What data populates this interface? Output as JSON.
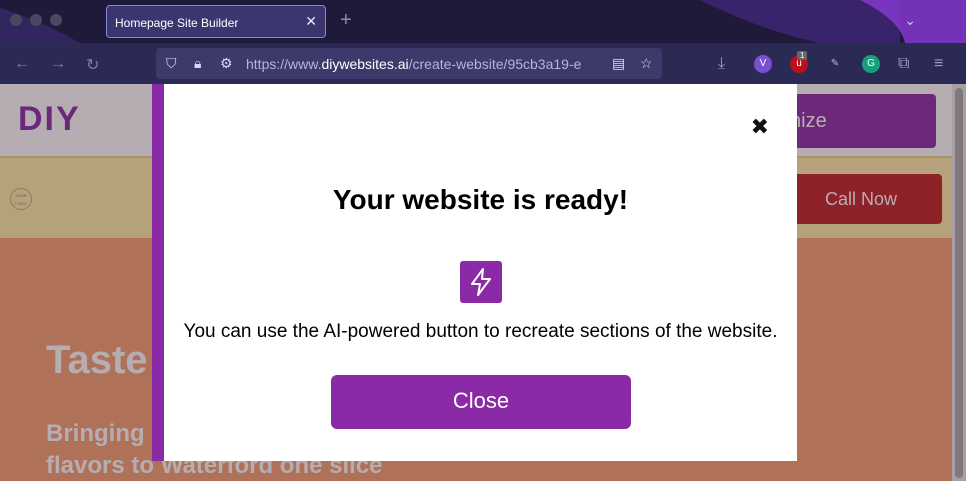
{
  "browser": {
    "tab_title": "Homepage Site Builder",
    "tab_close_glyph": "✕",
    "new_tab_glyph": "+",
    "overflow_glyph": "⌄",
    "url_prefix": "https://www.",
    "url_host": "diywebsites.ai",
    "url_path": "/create-website/95cb3a19-e",
    "extension_badge": "1"
  },
  "site": {
    "logo": "DIY",
    "customize_label": "nize",
    "promo_logo_text": "YOUR LOGO",
    "call_label": "Call Now",
    "hero_title": "Taste",
    "hero_sub_line1": "Bringing",
    "hero_sub_line2": "flavors to Waterford one slice"
  },
  "modal": {
    "close_glyph": "✖",
    "title": "Your website is ready!",
    "body": "You can use the AI-powered button to recreate sections of the website.",
    "button_label": "Close",
    "icon": "lightning-bolt-icon"
  },
  "colors": {
    "accent": "#8a2aa6",
    "call_button": "#c21f24",
    "hero": "#f5a171",
    "promo": "#ffeea8"
  }
}
